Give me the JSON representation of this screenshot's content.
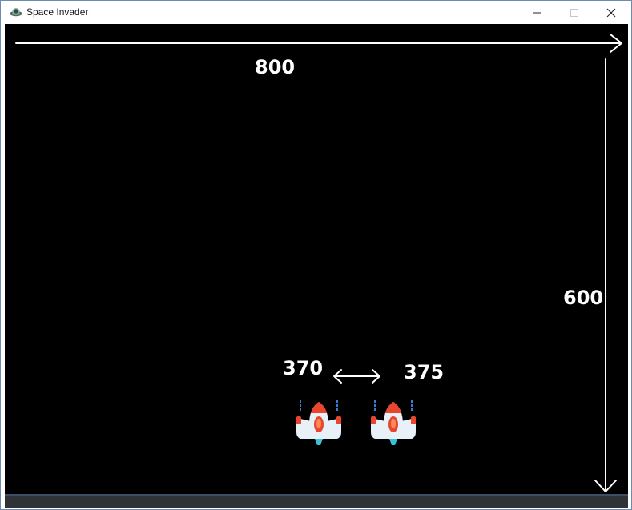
{
  "window": {
    "title": "Space Invader",
    "icon": "ufo-icon",
    "controls": [
      "minimize-icon",
      "maximize-icon",
      "close-icon"
    ]
  },
  "annotations": {
    "width_label": "800",
    "height_label": "600",
    "pos_start_label": "370",
    "pos_end_label": "375"
  },
  "sprites": [
    {
      "name": "player-spaceship",
      "icon": "spaceship-icon"
    },
    {
      "name": "player-spaceship-moved",
      "icon": "spaceship-icon"
    }
  ],
  "colors": {
    "background": "#000000",
    "annotation": "#ffffff",
    "ship_body": "#e8f0f8",
    "ship_accent": "#e8472e",
    "ship_thruster": "#37c2d8",
    "ship_exhaust": "#3a7bd5"
  }
}
